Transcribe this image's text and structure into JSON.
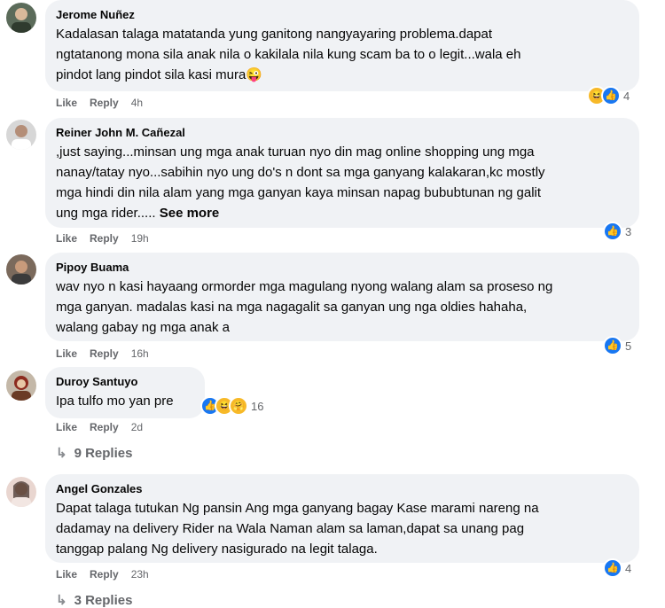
{
  "actions": {
    "like": "Like",
    "reply": "Reply"
  },
  "comments": [
    {
      "author": "Jerome Nuñez",
      "text": "Kadalasan talaga matatanda yung ganitong nangyayaring problema.dapat\nngtatanong mona sila anak nila o kakilala nila kung scam ba to o legit...wala eh\npindot lang pindot sila kasi mura😜",
      "time": "4h",
      "reactions": {
        "icons": [
          "haha",
          "like"
        ],
        "count": "4"
      }
    },
    {
      "author": "Reiner John M. Cañezal",
      "text": ",just saying...minsan ung mga anak turuan nyo din mag online shopping ung mga\nnanay/tatay nyo...sabihin nyo ung do's n dont sa mga ganyang kalakaran,kc mostly\nmga hindi din nila alam yang mga ganyan kaya minsan napag bububtunan ng galit\nung mga rider.....",
      "see_more": "See more",
      "time": "19h",
      "reactions": {
        "icons": [
          "like"
        ],
        "count": "3"
      }
    },
    {
      "author": "Pipoy Buama",
      "text": "wav nyo n kasi hayaang ormorder mga magulang nyong walang alam sa proseso ng\nmga ganyan. madalas kasi na mga nagagalit sa ganyan ung nga oldies hahaha,\nwalang gabay ng mga anak a",
      "time": "16h",
      "reactions": {
        "icons": [
          "like"
        ],
        "count": "5"
      }
    },
    {
      "author": "Duroy Santuyo",
      "text": "Ipa tulfo mo yan pre",
      "time": "2d",
      "reactions": {
        "icons": [
          "like",
          "haha",
          "care"
        ],
        "count": "16"
      },
      "replies": "9 Replies"
    },
    {
      "author": "Angel Gonzales",
      "text": "Dapat talaga tutukan Ng pansin Ang mga ganyang bagay Kase marami nareng na\ndadamay na delivery Rider na Wala Naman alam sa laman,dapat sa unang pag\ntanggap palang Ng delivery nasigurado na legit talaga.",
      "time": "23h",
      "reactions": {
        "icons": [
          "like"
        ],
        "count": "4"
      },
      "replies": "3 Replies"
    }
  ]
}
